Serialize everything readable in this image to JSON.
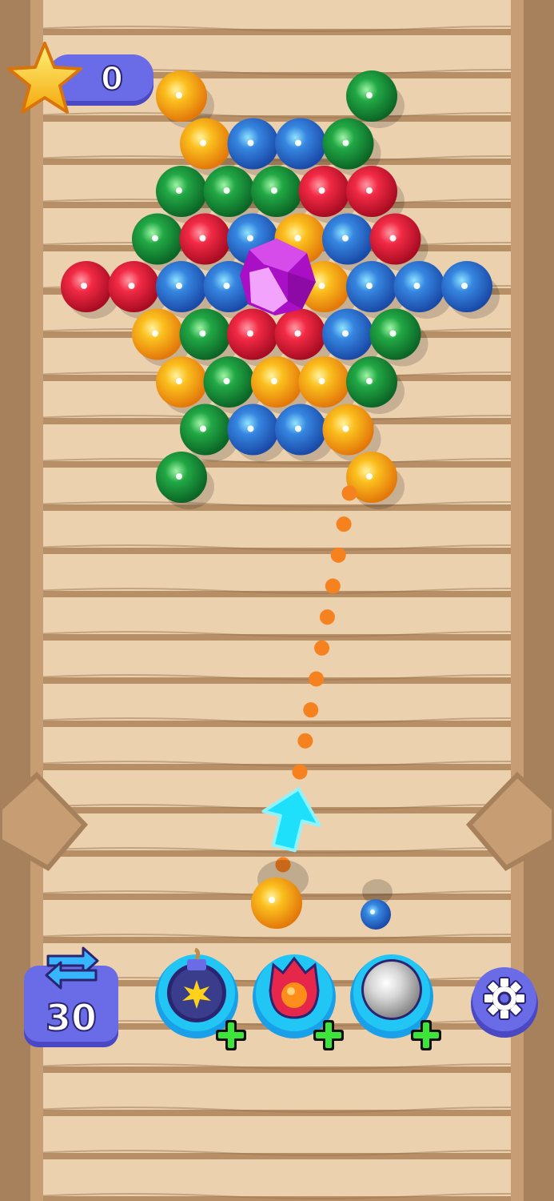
{
  "hud": {
    "score": "0",
    "shots_remaining": "30"
  },
  "icons": {
    "score": "star-icon",
    "swap": "swap-arrows-icon",
    "settings": "gear-icon",
    "aim": "aim-arrow-icon",
    "gem": "gem-icon"
  },
  "boosters": [
    {
      "name": "bomb-booster",
      "icon": "bomb-icon",
      "add": "plus-icon"
    },
    {
      "name": "fire-booster",
      "icon": "fire-icon",
      "add": "plus-icon"
    },
    {
      "name": "silver-ball-booster",
      "icon": "silver-ball-icon",
      "add": "plus-icon"
    }
  ],
  "colors": {
    "red": "#e5203b",
    "blue": "#2f76d8",
    "green": "#1c9a3e",
    "yellow": "#f6b219",
    "aim_dots": "#f5811f",
    "aim_arrow": "#1fd8f7",
    "hud": "#6a6be6",
    "gem": "#c21fd8"
  },
  "grid_rows": [
    [
      "yellow",
      null,
      null,
      null,
      "green"
    ],
    [
      "yellow",
      "blue",
      "blue",
      "green"
    ],
    [
      "green",
      "green",
      "green",
      "red",
      "red"
    ],
    [
      "green",
      "red",
      "blue",
      "yellow",
      "blue",
      "red"
    ],
    [
      "red",
      "red",
      "blue",
      "blue",
      "gem",
      "yellow",
      "blue",
      "blue",
      "blue"
    ],
    [
      "yellow",
      "green",
      "red",
      "red",
      "blue",
      "green"
    ],
    [
      "yellow",
      "green",
      "yellow",
      "yellow",
      "green"
    ],
    [
      "green",
      "blue",
      "blue",
      "yellow"
    ],
    [
      "green",
      null,
      null,
      null,
      "yellow"
    ]
  ],
  "shooter": {
    "current_ball": "yellow",
    "next_ball": "blue"
  }
}
